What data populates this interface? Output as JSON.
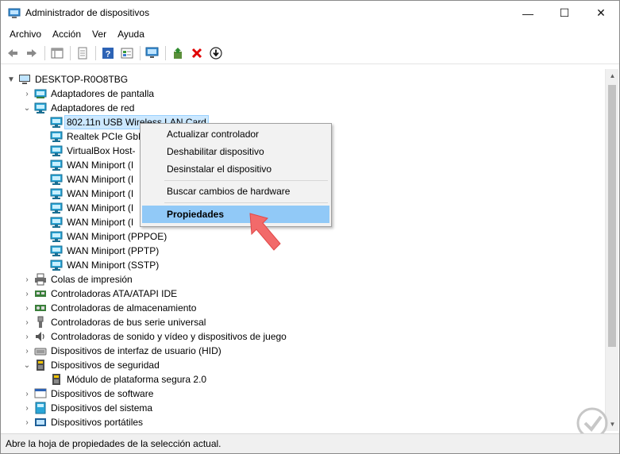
{
  "window": {
    "title": "Administrador de dispositivos",
    "minimize_glyph": "—",
    "maximize_glyph": "☐",
    "close_glyph": "✕"
  },
  "menu": [
    "Archivo",
    "Acción",
    "Ver",
    "Ayuda"
  ],
  "toolbar_icons": [
    "back-icon",
    "forward-icon",
    "properties-list-icon",
    "view-icon",
    "help-icon",
    "view-devices-icon",
    "monitor-icon",
    "update-driver-icon",
    "uninstall-icon",
    "disable-icon"
  ],
  "tree": {
    "root": "DESKTOP-R0O8TBG",
    "items": [
      {
        "label": "Adaptadores de pantalla",
        "expanded": false,
        "level": 1,
        "icon": "display-adapter-icon"
      },
      {
        "label": "Adaptadores de red",
        "expanded": true,
        "level": 1,
        "icon": "network-adapter-icon"
      },
      {
        "label": "802.11n USB Wireless LAN Card",
        "level": 2,
        "icon": "network-adapter-icon",
        "selected": true
      },
      {
        "label": "Realtek PCIe GbE",
        "level": 2,
        "icon": "network-adapter-icon"
      },
      {
        "label": "VirtualBox Host-",
        "level": 2,
        "icon": "network-adapter-icon"
      },
      {
        "label": "WAN Miniport (I",
        "level": 2,
        "icon": "network-adapter-icon"
      },
      {
        "label": "WAN Miniport (I",
        "level": 2,
        "icon": "network-adapter-icon"
      },
      {
        "label": "WAN Miniport (I",
        "level": 2,
        "icon": "network-adapter-icon"
      },
      {
        "label": "WAN Miniport (I",
        "level": 2,
        "icon": "network-adapter-icon"
      },
      {
        "label": "WAN Miniport (I",
        "level": 2,
        "icon": "network-adapter-icon"
      },
      {
        "label": "WAN Miniport (PPPOE)",
        "level": 2,
        "icon": "network-adapter-icon"
      },
      {
        "label": "WAN Miniport (PPTP)",
        "level": 2,
        "icon": "network-adapter-icon"
      },
      {
        "label": "WAN Miniport (SSTP)",
        "level": 2,
        "icon": "network-adapter-icon"
      },
      {
        "label": "Colas de impresión",
        "expanded": false,
        "level": 1,
        "icon": "printer-icon"
      },
      {
        "label": "Controladoras ATA/ATAPI IDE",
        "expanded": false,
        "level": 1,
        "icon": "ide-controller-icon"
      },
      {
        "label": "Controladoras de almacenamiento",
        "expanded": false,
        "level": 1,
        "icon": "storage-controller-icon"
      },
      {
        "label": "Controladoras de bus serie universal",
        "expanded": false,
        "level": 1,
        "icon": "usb-icon"
      },
      {
        "label": "Controladoras de sonido y vídeo y dispositivos de juego",
        "expanded": false,
        "level": 1,
        "icon": "sound-icon"
      },
      {
        "label": "Dispositivos de interfaz de usuario (HID)",
        "expanded": false,
        "level": 1,
        "icon": "hid-icon"
      },
      {
        "label": "Dispositivos de seguridad",
        "expanded": true,
        "level": 1,
        "icon": "security-device-icon"
      },
      {
        "label": "Módulo de plataforma segura 2.0",
        "level": 2,
        "icon": "security-device-icon"
      },
      {
        "label": "Dispositivos de software",
        "expanded": false,
        "level": 1,
        "icon": "software-device-icon"
      },
      {
        "label": "Dispositivos del sistema",
        "expanded": false,
        "level": 1,
        "icon": "system-device-icon"
      },
      {
        "label": "Dispositivos portátiles",
        "expanded": false,
        "level": 1,
        "icon": "portable-device-icon"
      }
    ]
  },
  "context_menu": {
    "items": [
      "Actualizar controlador",
      "Deshabilitar dispositivo",
      "Desinstalar el dispositivo",
      "Buscar cambios de hardware",
      "Propiedades"
    ],
    "highlighted": "Propiedades"
  },
  "status": "Abre la hoja de propiedades de la selección actual.",
  "colors": {
    "selection": "#cce8ff",
    "menu_hover": "#91c9f7",
    "pointer_arrow": "#f26a6a",
    "network_icon": "#2aa6d8"
  }
}
